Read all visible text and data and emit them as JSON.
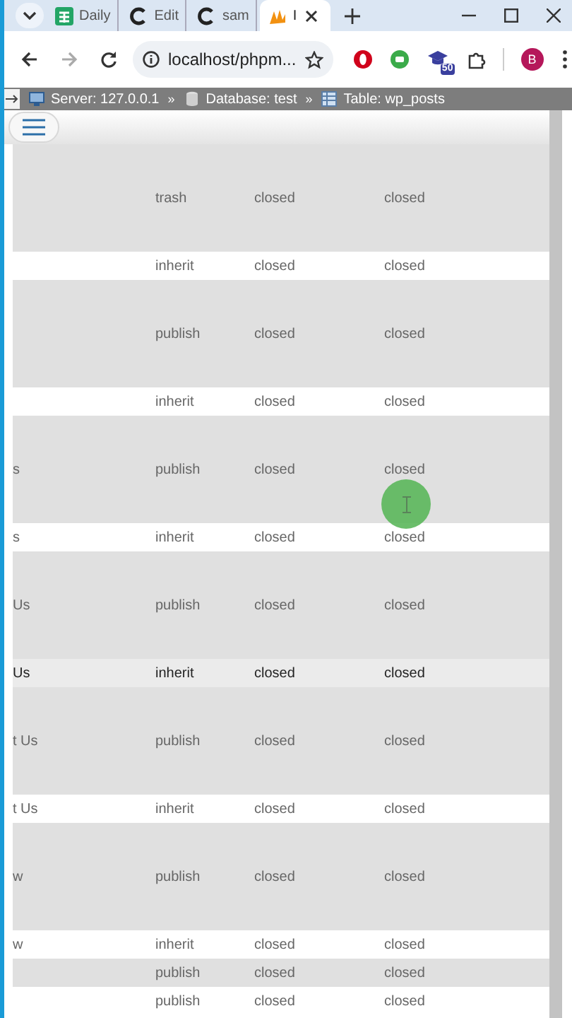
{
  "browser": {
    "tabs": [
      {
        "title": "Daily",
        "kind": "sheets",
        "selected": false
      },
      {
        "title": "Edit",
        "kind": "c",
        "selected": false
      },
      {
        "title": "sam",
        "kind": "c",
        "selected": false
      },
      {
        "title": "I",
        "kind": "pma",
        "selected": true
      }
    ],
    "address": "localhost/phpm...",
    "forward_enabled": false,
    "extension_badge": "50",
    "profile_initial": "B"
  },
  "breadcrumb": [
    {
      "kind": "server",
      "label": "Server: 127.0.0.1"
    },
    {
      "kind": "separator",
      "label": "»"
    },
    {
      "kind": "database",
      "label": "Database: test"
    },
    {
      "kind": "separator",
      "label": "»"
    },
    {
      "kind": "table",
      "label": "Table: wp_posts"
    }
  ],
  "cursor_highlight": true,
  "table": {
    "rows": [
      {
        "tall": true,
        "shaded": true,
        "hovered": false,
        "column_2": "trash",
        "column_3": "closed",
        "column_4": "closed"
      },
      {
        "tall": false,
        "shaded": false,
        "hovered": false,
        "column_2": "inherit",
        "column_3": "closed",
        "column_4": "closed"
      },
      {
        "tall": true,
        "shaded": true,
        "hovered": false,
        "column_2": "publish",
        "column_3": "closed",
        "column_4": "closed"
      },
      {
        "tall": false,
        "shaded": false,
        "hovered": false,
        "column_2": "inherit",
        "column_3": "closed",
        "column_4": "closed"
      },
      {
        "tall": true,
        "shaded": true,
        "hovered": false,
        "column_1": "s",
        "column_2": "publish",
        "column_3": "closed",
        "column_4": "closed"
      },
      {
        "tall": false,
        "shaded": false,
        "hovered": false,
        "column_1": "s",
        "column_2": "inherit",
        "column_3": "closed",
        "column_4": "closed"
      },
      {
        "tall": true,
        "shaded": true,
        "hovered": false,
        "column_1": "Us",
        "column_2": "publish",
        "column_3": "closed",
        "column_4": "closed"
      },
      {
        "tall": false,
        "shaded": false,
        "hovered": true,
        "column_1": "Us",
        "column_2": "inherit",
        "column_3": "closed",
        "column_4": "closed"
      },
      {
        "tall": true,
        "shaded": true,
        "hovered": false,
        "column_1": "t Us",
        "column_2": "publish",
        "column_3": "closed",
        "column_4": "closed"
      },
      {
        "tall": false,
        "shaded": false,
        "hovered": false,
        "column_1": "t Us",
        "column_2": "inherit",
        "column_3": "closed",
        "column_4": "closed"
      },
      {
        "tall": true,
        "shaded": true,
        "hovered": false,
        "column_1": "w",
        "column_2": "publish",
        "column_3": "closed",
        "column_4": "closed"
      },
      {
        "tall": false,
        "shaded": false,
        "hovered": false,
        "column_1": "w",
        "column_2": "inherit",
        "column_3": "closed",
        "column_4": "closed"
      },
      {
        "tall": false,
        "shaded": true,
        "hovered": false,
        "column_2": "publish",
        "column_3": "closed",
        "column_4": "closed"
      },
      {
        "tall": false,
        "shaded": false,
        "hovered": false,
        "column_2": "publish",
        "column_3": "closed",
        "column_4": "closed"
      }
    ]
  }
}
